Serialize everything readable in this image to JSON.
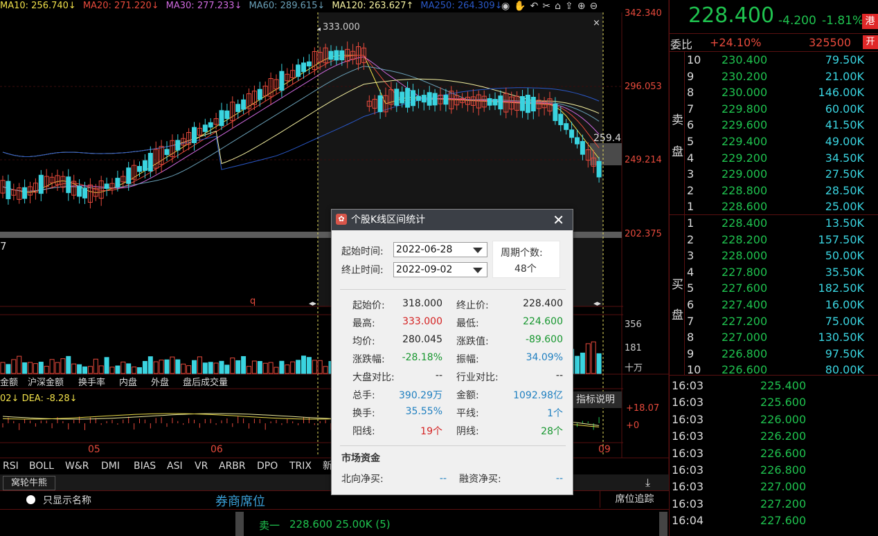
{
  "ma_bar": {
    "ma10": "MA10: 256.740↓",
    "ma20": "MA20: 271.220↓",
    "ma30": "MA30: 277.233↓",
    "ma60": "MA60: 289.615↓",
    "ma120": "MA120: 263.627↑",
    "ma250": "MA250: 264.309↓"
  },
  "price_axis": [
    "342.340",
    "296.053",
    "249.214",
    "202.375"
  ],
  "chart_labels": {
    "high_marker": "333.000",
    "current_marker": "259.4",
    "left_edge": "7",
    "q_marker": "q",
    "vol_axis": [
      "356",
      "181",
      "十万"
    ],
    "macd_axis": [
      "+18.07",
      "+0"
    ],
    "months": [
      "05",
      "06",
      "09"
    ],
    "macd_header": "02↓  DEA: -8.28↓",
    "indicator_help": "指标说明"
  },
  "sub_tabs": [
    "金额",
    "沪深金额",
    "换手率",
    "内盘",
    "外盘",
    "盘后成交量"
  ],
  "indicator_tabs": [
    "RSI",
    "BOLL",
    "W&R",
    "DMI",
    "BIAS",
    "ASI",
    "VR",
    "ARBR",
    "DPO",
    "TRIX",
    "新"
  ],
  "bottom": {
    "tab": "窝轮牛熊",
    "radio_label": "只显示名称",
    "broker_title": "券商席位",
    "seat_track": "席位追踪",
    "sell_one": "卖一",
    "sell_one_detail": "228.600 25.00K (5)"
  },
  "quote": {
    "price": "228.400",
    "change": "-4.200",
    "change_pct": "-1.81%",
    "hk_badge": "港",
    "weibi_label": "委比",
    "weibi": "+24.10%",
    "weicha": "325500",
    "open_badge": "开",
    "sell_label": [
      "卖",
      "盘"
    ],
    "buy_label": [
      "买",
      "盘"
    ]
  },
  "asks": [
    {
      "lv": "10",
      "price": "230.400",
      "vol": "79.50K"
    },
    {
      "lv": "9",
      "price": "230.200",
      "vol": "21.00K"
    },
    {
      "lv": "8",
      "price": "230.000",
      "vol": "146.00K"
    },
    {
      "lv": "7",
      "price": "229.800",
      "vol": "60.00K"
    },
    {
      "lv": "6",
      "price": "229.600",
      "vol": "41.50K"
    },
    {
      "lv": "5",
      "price": "229.400",
      "vol": "49.00K"
    },
    {
      "lv": "4",
      "price": "229.200",
      "vol": "34.50K"
    },
    {
      "lv": "3",
      "price": "229.000",
      "vol": "27.50K"
    },
    {
      "lv": "2",
      "price": "228.800",
      "vol": "28.50K"
    },
    {
      "lv": "1",
      "price": "228.600",
      "vol": "25.00K"
    }
  ],
  "bids": [
    {
      "lv": "1",
      "price": "228.400",
      "vol": "13.50K"
    },
    {
      "lv": "2",
      "price": "228.200",
      "vol": "157.50K"
    },
    {
      "lv": "3",
      "price": "228.000",
      "vol": "50.00K"
    },
    {
      "lv": "4",
      "price": "227.800",
      "vol": "35.50K"
    },
    {
      "lv": "5",
      "price": "227.600",
      "vol": "182.50K"
    },
    {
      "lv": "6",
      "price": "227.400",
      "vol": "16.00K"
    },
    {
      "lv": "7",
      "price": "227.200",
      "vol": "75.00K"
    },
    {
      "lv": "8",
      "price": "227.000",
      "vol": "130.50K"
    },
    {
      "lv": "9",
      "price": "226.800",
      "vol": "97.50K"
    },
    {
      "lv": "10",
      "price": "226.600",
      "vol": "80.00K"
    }
  ],
  "ticks": [
    {
      "t": "16:03",
      "p": "225.400"
    },
    {
      "t": "16:03",
      "p": "225.600"
    },
    {
      "t": "16:03",
      "p": "226.000"
    },
    {
      "t": "16:03",
      "p": "226.200"
    },
    {
      "t": "16:03",
      "p": "226.600"
    },
    {
      "t": "16:03",
      "p": "226.800"
    },
    {
      "t": "16:03",
      "p": "227.000"
    },
    {
      "t": "16:03",
      "p": "227.200"
    },
    {
      "t": "16:04",
      "p": "227.600"
    }
  ],
  "dialog": {
    "title": "个股K线区间统计",
    "start_label": "起始时间:",
    "start_value": "2022-06-28",
    "end_label": "终止时间:",
    "end_value": "2022-09-02",
    "period_label": "周期个数:",
    "period_value": "48个",
    "rows": [
      {
        "l1": "起始价:",
        "v1": "318.000",
        "c1": "#222",
        "l2": "终止价:",
        "v2": "228.400",
        "c2": "#222"
      },
      {
        "l1": "最高:",
        "v1": "333.000",
        "c1": "#d42020",
        "l2": "最低:",
        "v2": "224.600",
        "c2": "#16962e"
      },
      {
        "l1": "均价:",
        "v1": "280.045",
        "c1": "#222",
        "l2": "涨跌值:",
        "v2": "-89.600",
        "c2": "#16962e"
      },
      {
        "l1": "涨跌幅:",
        "v1": "-28.18%",
        "c1": "#16962e",
        "l2": "振幅:",
        "v2": "34.09%",
        "c2": "#1e7fc0"
      },
      {
        "l1": "大盘对比:",
        "v1": "--",
        "c1": "#222",
        "l2": "行业对比:",
        "v2": "--",
        "c2": "#222"
      },
      {
        "l1": "总手:",
        "v1": "390.29万",
        "c1": "#1e7fc0",
        "l2": "金额:",
        "v2": "1092.98亿",
        "c2": "#1e7fc0"
      },
      {
        "l1": "换手:",
        "v1": "35.55%",
        "c1": "#1e7fc0",
        "l2": "平线:",
        "v2": "1个",
        "c2": "#1e7fc0"
      },
      {
        "l1": "阳线:",
        "v1": "19个",
        "c1": "#d42020",
        "l2": "阴线:",
        "v2": "28个",
        "c2": "#16962e"
      }
    ],
    "market_funds": "市场资金",
    "north_label": "北向净买:",
    "north_value": "--",
    "margin_label": "融资净买:",
    "margin_value": "--"
  }
}
